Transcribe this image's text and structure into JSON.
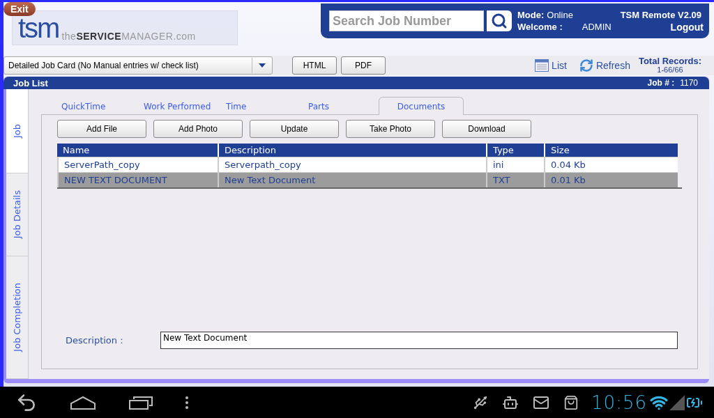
{
  "header": {
    "exit_button": "Exit",
    "logo": {
      "mark": "tsm",
      "wordmark": "the**SERVICE**MANAGER.com"
    },
    "search": {
      "placeholder": "Search Job Number"
    },
    "mode_label": "Mode:",
    "mode_value": "Online",
    "app_title": "TSM Remote V2.09",
    "welcome_label": "Welcome :",
    "user": "ADMIN",
    "logout": "Logout"
  },
  "toolbar": {
    "report_select": "Detailed Job Card (No Manual entries w/ check list)",
    "buttons": [
      "HTML",
      "PDF"
    ],
    "list_button": "List",
    "refresh_button": "Refresh",
    "total_label": "Total Records:",
    "total_value": "1-66/66"
  },
  "panel": {
    "title": "Job List",
    "job_label": "Job # :",
    "job_value": "1170"
  },
  "side_tabs": [
    {
      "label": "Job",
      "selected": true
    },
    {
      "label": "Job Details",
      "selected": false
    },
    {
      "label": "Job Completion",
      "selected": false
    }
  ],
  "tabs": [
    {
      "label": "QuickTime",
      "selected": false
    },
    {
      "label": "Work Performed",
      "selected": false
    },
    {
      "label": "Time",
      "selected": false
    },
    {
      "label": "Parts",
      "selected": false
    },
    {
      "label": "Documents",
      "selected": true
    }
  ],
  "actions": [
    "Add File",
    "Add Photo",
    "Update",
    "Take Photo",
    "Download"
  ],
  "table": {
    "columns": [
      "Name",
      "Description",
      "Type",
      "Size"
    ],
    "rows": [
      {
        "cells": [
          "ServerPath_copy",
          "Serverpath_copy",
          "ini",
          "0.04 Kb"
        ],
        "selected": false
      },
      {
        "cells": [
          "NEW TEXT DOCUMENT",
          "New Text Document",
          "TXT",
          "0.01 Kb"
        ],
        "selected": true
      }
    ]
  },
  "description": {
    "label": "Description :",
    "value": "New Text Document"
  },
  "system_bar": {
    "clock": "10:56"
  }
}
